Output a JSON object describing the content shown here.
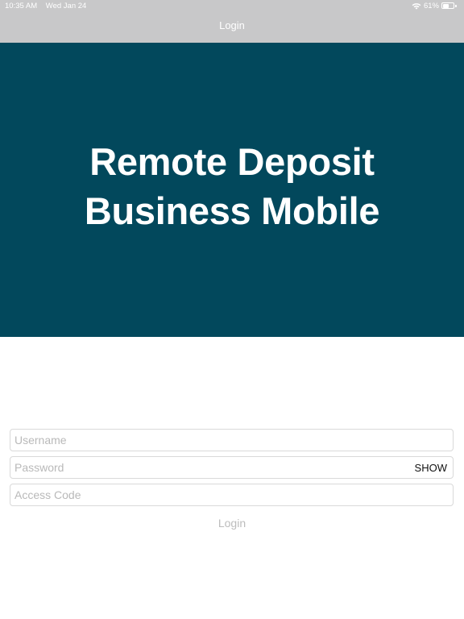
{
  "status_bar": {
    "time": "10:35 AM",
    "date": "Wed Jan 24",
    "battery_percent": "61%",
    "battery_level": 0.61,
    "icons": [
      "wifi-icon",
      "battery-icon"
    ]
  },
  "nav": {
    "title": "Login",
    "background_color": "#c8c8c9"
  },
  "hero": {
    "title_line1": "Remote Deposit",
    "title_line2": "Business Mobile",
    "background_color": "#02485c"
  },
  "form": {
    "username": {
      "value": "",
      "placeholder": "Username"
    },
    "password": {
      "value": "",
      "placeholder": "Password",
      "show_label": "SHOW"
    },
    "access_code": {
      "value": "",
      "placeholder": "Access Code"
    },
    "login_label": "Login",
    "login_color": "#bcbcbc"
  }
}
